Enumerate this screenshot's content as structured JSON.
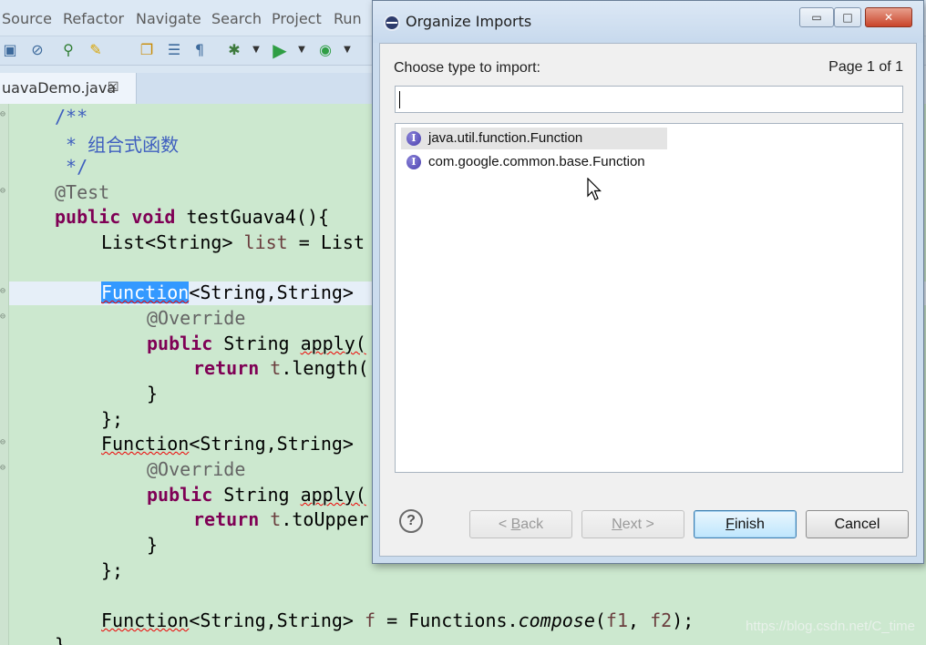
{
  "ide": {
    "menu": [
      "Source",
      "Refactor",
      "Navigate",
      "Search",
      "Project",
      "Run"
    ],
    "toolbar_icons": [
      "save-icon",
      "breakpoint-icon",
      "build-icon",
      "brush-icon",
      "copy-icon",
      "list-icon",
      "pilcrow-icon",
      "debug-icon",
      "dropdown-arrow-icon",
      "run-icon",
      "dropdown-arrow-icon",
      "coverage-icon",
      "dropdown-arrow-icon"
    ],
    "editor_tab": {
      "label": "uavaDemo.java",
      "close": "☒"
    }
  },
  "code": {
    "l1": "/**",
    "l2": " * 组合式函数",
    "l3": " */",
    "l4": "@Test",
    "l5_kw": "public void",
    "l5_rest": " testGuava4(){",
    "l6_type": "List<String>",
    "l6_var": "list",
    "l6_rest": " = List",
    "l8_sel": "Function",
    "l8_rest": "<String,String> ",
    "l9": "@Override",
    "l10_kw": "public",
    "l10_rest": " String ",
    "l10_method": "apply(",
    "l11_kw": "return",
    "l11_var": "t",
    "l11_rest": ".length(",
    "l12": "}",
    "l13": "};",
    "l14_type": "Function",
    "l14_rest": "<String,String> ",
    "l15": "@Override",
    "l16_kw": "public",
    "l16_rest": " String ",
    "l16_method": "apply(",
    "l17_kw": "return",
    "l17_var": "t",
    "l17_rest": ".toUpper",
    "l18": "}",
    "l19": "};",
    "l21_type": "Function",
    "l21_mid": "<String,String> ",
    "l21_var": "f",
    "l21_eq": " = Functions.",
    "l21_call": "compose",
    "l21_args_open": "(",
    "l21_a1": "f1",
    "l21_comma": ", ",
    "l21_a2": "f2",
    "l21_end": ");",
    "l22": "}"
  },
  "watermark": "https://blog.csdn.net/C_time",
  "dialog": {
    "title": "Organize Imports",
    "window_buttons": {
      "minimize": "▭",
      "maximize": "□",
      "close": "✕"
    },
    "prompt": "Choose type to import:",
    "page_info": "Page 1 of 1",
    "filter_value": "",
    "types": [
      {
        "name": "java.util.function.Function",
        "icon": "I",
        "selected": true
      },
      {
        "name": "com.google.common.base.Function",
        "icon": "I",
        "selected": false
      }
    ],
    "help": "?",
    "buttons": {
      "back_arrow": "< ",
      "back_mnemonic": "B",
      "back_rest": "ack",
      "next_mnemonic": "N",
      "next_rest": "ext >",
      "finish_mnemonic": "F",
      "finish_rest": "inish",
      "cancel": "Cancel"
    }
  },
  "colors": {
    "editor_bg": "#cce8cf",
    "keyword": "#7f0055",
    "comment": "#3f5fbf",
    "selection": "#3399ff",
    "default_button": "#bee6fd"
  }
}
